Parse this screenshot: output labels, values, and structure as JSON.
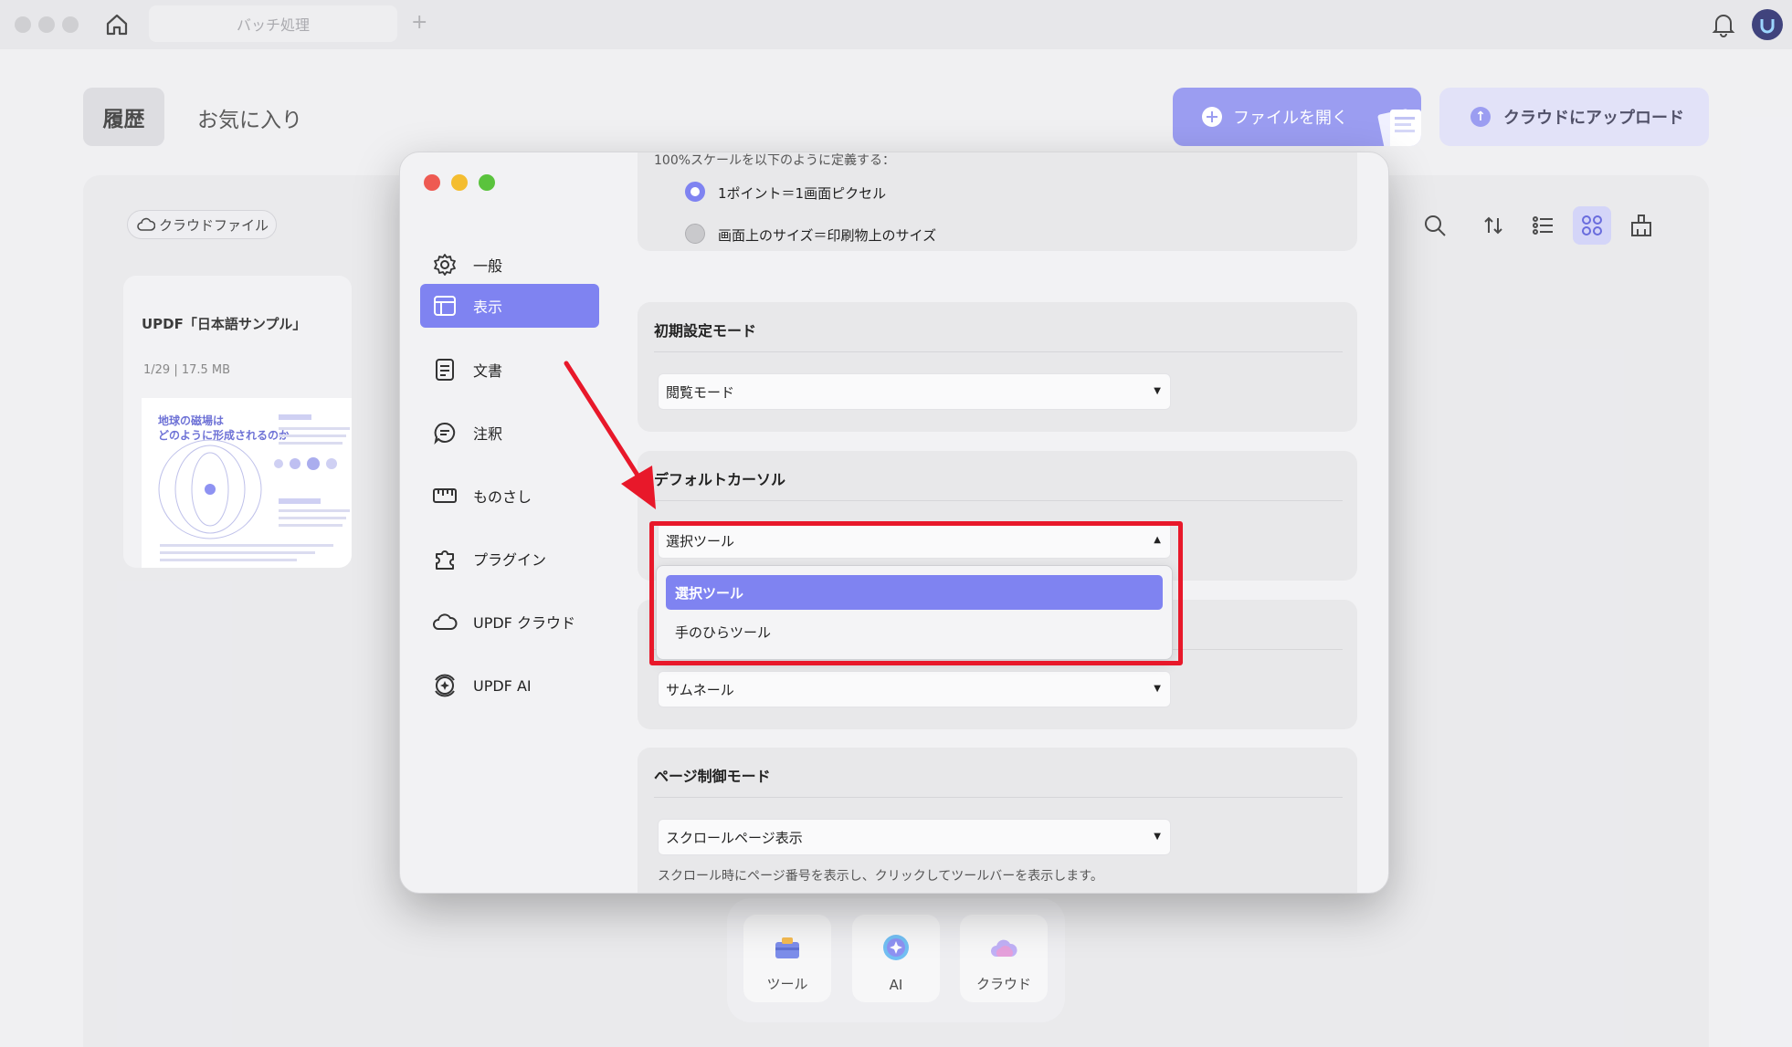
{
  "titlebar": {
    "tab_label": "バッチ処理",
    "tab_plus": "+"
  },
  "header": {
    "history_label": "履歴",
    "favorites_label": "お気に入り",
    "open_file_label": "ファイルを開く",
    "upload_label": "クラウドにアップロード"
  },
  "main": {
    "cloud_chip_label": "クラウドファイル",
    "file": {
      "title": "UPDF「日本語サンプル」",
      "meta": "1/29  |  17.5 MB",
      "thumb_title_line1": "地球の磁場は",
      "thumb_title_line2": "どのように形成されるのか"
    }
  },
  "dock": {
    "tools_label": "ツール",
    "ai_label": "AI",
    "cloud_label": "クラウド"
  },
  "prefs": {
    "sidebar": [
      {
        "label": "一般",
        "icon": "gear-icon"
      },
      {
        "label": "表示",
        "icon": "layout-icon"
      },
      {
        "label": "文書",
        "icon": "document-icon"
      },
      {
        "label": "注釈",
        "icon": "comment-icon"
      },
      {
        "label": "ものさし",
        "icon": "ruler-icon"
      },
      {
        "label": "プラグイン",
        "icon": "puzzle-icon"
      },
      {
        "label": "UPDF クラウド",
        "icon": "cloud-icon"
      },
      {
        "label": "UPDF AI",
        "icon": "ai-icon"
      }
    ],
    "scale": {
      "caption": "100%スケールを以下のように定義する：",
      "option1": "1ポイント＝1画面ピクセル",
      "option2": "画面上のサイズ＝印刷物上のサイズ",
      "selected": "option1"
    },
    "initial_mode": {
      "title": "初期設定モード",
      "value": "閲覧モード"
    },
    "default_cursor": {
      "title": "デフォルトカーソル",
      "value": "選択ツール",
      "options": [
        "選択ツール",
        "手のひらツール"
      ]
    },
    "thumbnail": {
      "value": "サムネール"
    },
    "page_control": {
      "title": "ページ制御モード",
      "value": "スクロールページ表示",
      "note": "スクロール時にページ番号を表示し、クリックしてツールバーを表示します。"
    }
  },
  "colors": {
    "accent": "#7f83f1",
    "highlight": "#e8182a"
  }
}
